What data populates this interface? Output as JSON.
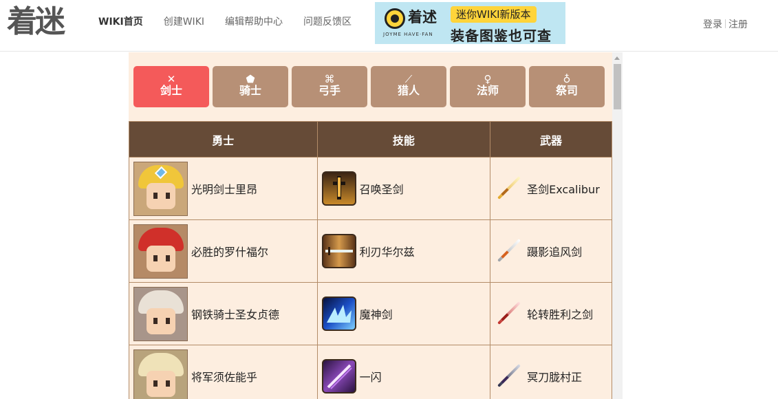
{
  "header": {
    "logo_text": "着迷",
    "nav": [
      {
        "label": "WIKI首页",
        "active": true
      },
      {
        "label": "创建WIKI",
        "active": false
      },
      {
        "label": "编辑帮助中心",
        "active": false
      },
      {
        "label": "问题反馈区",
        "active": false
      }
    ],
    "banner": {
      "brand": "着述",
      "sub": "JOYME HAVE·FAN",
      "tag": "迷你WIKI新版本",
      "main": "装备图鉴也可查"
    },
    "login_label": "登录",
    "register_label": "注册"
  },
  "classes": [
    {
      "label": "剑士",
      "icon": "✕",
      "icon_name": "sword-icon",
      "active": true
    },
    {
      "label": "骑士",
      "icon": "⬟",
      "icon_name": "shield-icon",
      "active": false
    },
    {
      "label": "弓手",
      "icon": "⌘",
      "icon_name": "bow-icon",
      "active": false
    },
    {
      "label": "猎人",
      "icon": "⟋",
      "icon_name": "dagger-icon",
      "active": false
    },
    {
      "label": "法师",
      "icon": "♀",
      "icon_name": "staff-icon",
      "active": false
    },
    {
      "label": "祭司",
      "icon": "♁",
      "icon_name": "cross-icon",
      "active": false
    }
  ],
  "table": {
    "headers": [
      "勇士",
      "技能",
      "武器"
    ],
    "rows": [
      {
        "hero": "光明剑士里昂",
        "skill": "召唤圣剑",
        "weapon": "圣剑Excalibur"
      },
      {
        "hero": "必胜的罗什福尔",
        "skill": "利刃华尔兹",
        "weapon": "蹑影追风剑"
      },
      {
        "hero": "钢铁骑士圣女贞德",
        "skill": "魔神剑",
        "weapon": "轮转胜利之剑"
      },
      {
        "hero": "将军须佐能乎",
        "skill": "一闪",
        "weapon": "冥刀胧村正"
      }
    ]
  },
  "colors": {
    "active_tab": "#f45a5a",
    "tab": "#b79076",
    "table_header": "#664b37",
    "table_bg": "#fdeee0"
  }
}
